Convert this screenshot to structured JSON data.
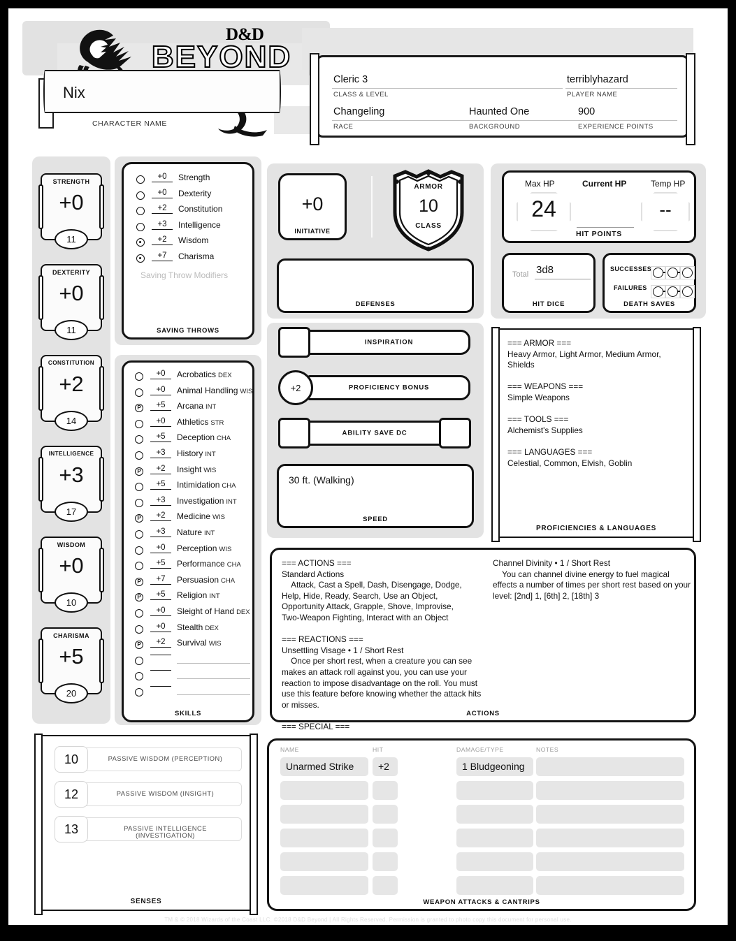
{
  "header": {
    "logo_dnd": "D&D",
    "logo_beyond": "BEYOND",
    "character_name": "Nix",
    "character_name_label": "CHARACTER NAME",
    "info": {
      "class_level": {
        "value": "Cleric 3",
        "label": "CLASS & LEVEL"
      },
      "player_name": {
        "value": "terriblyhazard",
        "label": "PLAYER NAME"
      },
      "race": {
        "value": "Changeling",
        "label": "RACE"
      },
      "background": {
        "value": "Haunted One",
        "label": "BACKGROUND"
      },
      "experience_points": {
        "value": "900",
        "label": "EXPERIENCE POINTS"
      }
    }
  },
  "abilities": [
    {
      "name": "STRENGTH",
      "mod": "+0",
      "score": "11"
    },
    {
      "name": "DEXTERITY",
      "mod": "+0",
      "score": "11"
    },
    {
      "name": "CONSTITUTION",
      "mod": "+2",
      "score": "14"
    },
    {
      "name": "INTELLIGENCE",
      "mod": "+3",
      "score": "17"
    },
    {
      "name": "WISDOM",
      "mod": "+0",
      "score": "10"
    },
    {
      "name": "CHARISMA",
      "mod": "+5",
      "score": "20"
    }
  ],
  "saving_throws": {
    "caption": "SAVING THROWS",
    "note": "Saving Throw Modifiers",
    "items": [
      {
        "mod": "+0",
        "name": "Strength",
        "proficient": false
      },
      {
        "mod": "+0",
        "name": "Dexterity",
        "proficient": false
      },
      {
        "mod": "+2",
        "name": "Constitution",
        "proficient": false
      },
      {
        "mod": "+3",
        "name": "Intelligence",
        "proficient": false
      },
      {
        "mod": "+2",
        "name": "Wisdom",
        "proficient": true
      },
      {
        "mod": "+7",
        "name": "Charisma",
        "proficient": true
      }
    ]
  },
  "skills": {
    "caption": "SKILLS",
    "items": [
      {
        "mod": "+0",
        "name": "Acrobatics",
        "abbr": "DEX",
        "prof": "none"
      },
      {
        "mod": "+0",
        "name": "Animal Handling",
        "abbr": "WIS",
        "prof": "none"
      },
      {
        "mod": "+5",
        "name": "Arcana",
        "abbr": "INT",
        "prof": "P"
      },
      {
        "mod": "+0",
        "name": "Athletics",
        "abbr": "STR",
        "prof": "none"
      },
      {
        "mod": "+5",
        "name": "Deception",
        "abbr": "CHA",
        "prof": "none"
      },
      {
        "mod": "+3",
        "name": "History",
        "abbr": "INT",
        "prof": "none"
      },
      {
        "mod": "+2",
        "name": "Insight",
        "abbr": "WIS",
        "prof": "P"
      },
      {
        "mod": "+5",
        "name": "Intimidation",
        "abbr": "CHA",
        "prof": "none"
      },
      {
        "mod": "+3",
        "name": "Investigation",
        "abbr": "INT",
        "prof": "none"
      },
      {
        "mod": "+2",
        "name": "Medicine",
        "abbr": "WIS",
        "prof": "P"
      },
      {
        "mod": "+3",
        "name": "Nature",
        "abbr": "INT",
        "prof": "none"
      },
      {
        "mod": "+0",
        "name": "Perception",
        "abbr": "WIS",
        "prof": "none"
      },
      {
        "mod": "+5",
        "name": "Performance",
        "abbr": "CHA",
        "prof": "none"
      },
      {
        "mod": "+7",
        "name": "Persuasion",
        "abbr": "CHA",
        "prof": "P"
      },
      {
        "mod": "+5",
        "name": "Religion",
        "abbr": "INT",
        "prof": "P"
      },
      {
        "mod": "+0",
        "name": "Sleight of Hand",
        "abbr": "DEX",
        "prof": "none"
      },
      {
        "mod": "+0",
        "name": "Stealth",
        "abbr": "DEX",
        "prof": "none"
      },
      {
        "mod": "+2",
        "name": "Survival",
        "abbr": "WIS",
        "prof": "P"
      },
      {
        "mod": "",
        "name": "",
        "abbr": "",
        "prof": "none"
      },
      {
        "mod": "",
        "name": "",
        "abbr": "",
        "prof": "none"
      },
      {
        "mod": "",
        "name": "",
        "abbr": "",
        "prof": "none"
      }
    ]
  },
  "combat": {
    "initiative": {
      "value": "+0",
      "label": "INITIATIVE"
    },
    "armor_class": {
      "armor_label": "ARMOR",
      "value": "10",
      "class_label": "CLASS"
    },
    "defenses": {
      "label": "DEFENSES",
      "value": ""
    },
    "inspiration": {
      "label": "INSPIRATION",
      "value": ""
    },
    "proficiency_bonus": {
      "label": "PROFICIENCY BONUS",
      "value": "+2"
    },
    "ability_save_dc": {
      "label": "ABILITY SAVE DC",
      "value": ""
    },
    "speed": {
      "label": "SPEED",
      "value": "30 ft. (Walking)"
    }
  },
  "hit_points": {
    "caption": "HIT POINTS",
    "max_hp_label": "Max HP",
    "max_hp": "24",
    "current_hp_label": "Current HP",
    "current_hp": "",
    "temp_hp_label": "Temp HP",
    "temp_hp": "--"
  },
  "hit_dice": {
    "caption": "HIT DICE",
    "total_label": "Total",
    "value": "3d8"
  },
  "death_saves": {
    "caption": "DEATH SAVES",
    "successes_label": "SUCCESSES",
    "failures_label": "FAILURES",
    "successes": 0,
    "failures": 0
  },
  "proficiencies": {
    "caption": "PROFICIENCIES & LANGUAGES",
    "text": "=== ARMOR ===\nHeavy Armor, Light Armor, Medium Armor,\nShields\n\n=== WEAPONS ===\nSimple Weapons\n\n=== TOOLS ===\nAlchemist's Supplies\n\n=== LANGUAGES ===\nCelestial, Common, Elvish, Goblin"
  },
  "actions": {
    "caption": "ACTIONS",
    "left_text": "=== ACTIONS ===\nStandard Actions\n    Attack, Cast a Spell, Dash, Disengage, Dodge,\nHelp, Hide, Ready, Search, Use an Object,\nOpportunity Attack, Grapple, Shove, Improvise,\nTwo-Weapon Fighting, Interact with an Object\n\n=== REACTIONS ===\nUnsettling Visage • 1 / Short Rest\n    Once per short rest, when a creature you can see\nmakes an attack roll against you, you can use your\nreaction to impose disadvantage on the roll. You must\nuse this feature before knowing whether the attack hits\nor misses.\n\n=== SPECIAL ===",
    "right_text": "Channel Divinity • 1 / Short Rest\n    You can channel divine energy to fuel magical\neffects a number of times per short rest based on your\nlevel: [2nd] 1, [6th] 2, [18th] 3"
  },
  "senses": {
    "caption": "SENSES",
    "items": [
      {
        "value": "10",
        "label": "PASSIVE WISDOM (PERCEPTION)"
      },
      {
        "value": "12",
        "label": "PASSIVE WISDOM (INSIGHT)"
      },
      {
        "value": "13",
        "label": "PASSIVE INTELLIGENCE (INVESTIGATION)"
      }
    ]
  },
  "weapon_attacks": {
    "caption": "WEAPON ATTACKS & CANTRIPS",
    "columns": [
      "NAME",
      "HIT",
      "DAMAGE/TYPE",
      "NOTES"
    ],
    "rows": [
      {
        "name": "Unarmed Strike",
        "hit": "+2",
        "damage": "1 Bludgeoning",
        "notes": ""
      },
      {
        "name": "",
        "hit": "",
        "damage": "",
        "notes": ""
      },
      {
        "name": "",
        "hit": "",
        "damage": "",
        "notes": ""
      },
      {
        "name": "",
        "hit": "",
        "damage": "",
        "notes": ""
      },
      {
        "name": "",
        "hit": "",
        "damage": "",
        "notes": ""
      },
      {
        "name": "",
        "hit": "",
        "damage": "",
        "notes": ""
      }
    ]
  },
  "footer": {
    "text": "TM & © 2018 Wizards of the Coast LLC. ©2018 D&D Beyond | All Rights Reserved. Permission is granted to photo copy this document for personal use."
  }
}
